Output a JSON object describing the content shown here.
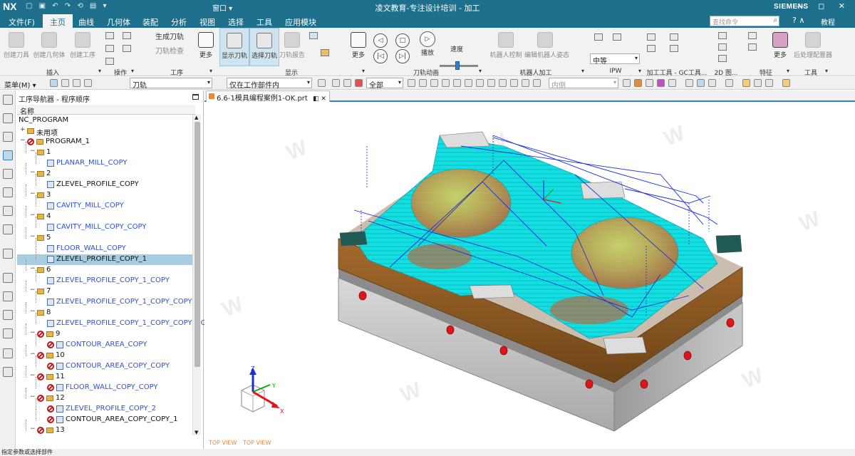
{
  "titlebar": {
    "logo": "NX",
    "quick_access": "▢ ▣ ↶ ↷ ⟲ ▤ ▾",
    "window_menu": "窗口 ▾",
    "title": "凌文教育-专注设计培训 - 加工",
    "brand": "SIEMENS",
    "window_controls": "— ◻ ✕"
  },
  "menubar": {
    "items": [
      "文件(F)",
      "主页",
      "曲线",
      "几何体",
      "装配",
      "分析",
      "视图",
      "选择",
      "工具",
      "应用模块"
    ],
    "active_index": 1,
    "search_placeholder": "查找命令",
    "help_label": "? ∧",
    "tutorial_label": "教程"
  },
  "ribbon": {
    "buttons": [
      {
        "label": "创建刀具",
        "enabled": false
      },
      {
        "label": "创建几何体",
        "enabled": false
      },
      {
        "label": "创建工序",
        "enabled": false
      },
      {
        "label": "生成刀轨",
        "enabled": false
      },
      {
        "label": "刀轨检查",
        "enabled": false
      },
      {
        "label": "更多",
        "enabled": true
      },
      {
        "label": "显示刀轨",
        "enabled": true,
        "toggled": true
      },
      {
        "label": "选择刀轨",
        "enabled": true,
        "toggled": true
      },
      {
        "label": "刀轨报告",
        "enabled": false
      },
      {
        "label": "更多",
        "enabled": true
      },
      {
        "label": "播放",
        "enabled": true
      },
      {
        "label": "速度",
        "enabled": true
      },
      {
        "label": "机器人控制",
        "enabled": false
      },
      {
        "label": "编辑机器人姿态",
        "enabled": false
      },
      {
        "label": "更多",
        "enabled": true
      },
      {
        "label": "后处理配置器",
        "enabled": false
      }
    ],
    "groups": [
      "插入",
      "操作",
      "工序",
      "显示",
      "刀轨动画",
      "机器人加工",
      "IPW",
      "加工工具 - GC工具...",
      "2D 图...",
      "特征",
      "工具"
    ],
    "ipw_select": "中等",
    "speed_value": 0.45
  },
  "toolbar2": {
    "menu_label": "菜单(M) ▾",
    "filter_select": "刀轨",
    "scope_select": "仅在工作部件内",
    "selection_select": "全部",
    "snap_select": "内侧"
  },
  "nav": {
    "title": "工序导航器 - 程序顺序",
    "column_name": "名称",
    "rows": [
      {
        "label": "NC_PROGRAM",
        "level": 0,
        "kind": "root",
        "expander": "",
        "color": "dark"
      },
      {
        "label": "未用项",
        "level": 0,
        "kind": "folder",
        "expander": "+",
        "color": "dark"
      },
      {
        "label": "PROGRAM_1",
        "level": 0,
        "kind": "program",
        "expander": "−",
        "color": "dark"
      },
      {
        "label": "1",
        "level": 1,
        "kind": "folder",
        "expander": "−",
        "color": "dark"
      },
      {
        "label": "PLANAR_MILL_COPY",
        "level": 2,
        "kind": "op",
        "expander": "",
        "color": "blue"
      },
      {
        "label": "2",
        "level": 1,
        "kind": "folder",
        "expander": "−",
        "color": "dark"
      },
      {
        "label": "ZLEVEL_PROFILE_COPY",
        "level": 2,
        "kind": "op",
        "expander": "",
        "color": "dark"
      },
      {
        "label": "3",
        "level": 1,
        "kind": "folder",
        "expander": "−",
        "color": "dark"
      },
      {
        "label": "CAVITY_MILL_COPY",
        "level": 2,
        "kind": "op",
        "expander": "",
        "color": "blue"
      },
      {
        "label": "4",
        "level": 1,
        "kind": "folder",
        "expander": "−",
        "color": "dark"
      },
      {
        "label": "CAVITY_MILL_COPY_COPY",
        "level": 2,
        "kind": "op",
        "expander": "",
        "color": "blue"
      },
      {
        "label": "5",
        "level": 1,
        "kind": "folder",
        "expander": "−",
        "color": "dark"
      },
      {
        "label": "FLOOR_WALL_COPY",
        "level": 2,
        "kind": "op",
        "expander": "",
        "color": "blue"
      },
      {
        "label": "ZLEVEL_PROFILE_COPY_1",
        "level": 2,
        "kind": "op",
        "expander": "",
        "color": "dark",
        "selected": true
      },
      {
        "label": "6",
        "level": 1,
        "kind": "folder",
        "expander": "−",
        "color": "dark"
      },
      {
        "label": "ZLEVEL_PROFILE_COPY_1_COPY",
        "level": 2,
        "kind": "op",
        "expander": "",
        "color": "blue"
      },
      {
        "label": "7",
        "level": 1,
        "kind": "folder",
        "expander": "−",
        "color": "dark"
      },
      {
        "label": "ZLEVEL_PROFILE_COPY_1_COPY_COPY",
        "level": 2,
        "kind": "op",
        "expander": "",
        "color": "blue"
      },
      {
        "label": "8",
        "level": 1,
        "kind": "folder",
        "expander": "−",
        "color": "dark"
      },
      {
        "label": "ZLEVEL_PROFILE_COPY_1_COPY_COPY_CO",
        "level": 2,
        "kind": "op",
        "expander": "",
        "color": "blue"
      },
      {
        "label": "9",
        "level": 1,
        "kind": "program",
        "expander": "−",
        "color": "dark"
      },
      {
        "label": "CONTOUR_AREA_COPY",
        "level": 2,
        "kind": "op-x",
        "expander": "",
        "color": "blue"
      },
      {
        "label": "10",
        "level": 1,
        "kind": "program",
        "expander": "−",
        "color": "dark"
      },
      {
        "label": "CONTOUR_AREA_COPY_COPY",
        "level": 2,
        "kind": "op-x",
        "expander": "",
        "color": "blue"
      },
      {
        "label": "11",
        "level": 1,
        "kind": "program",
        "expander": "−",
        "color": "dark"
      },
      {
        "label": "FLOOR_WALL_COPY_COPY",
        "level": 2,
        "kind": "op-x",
        "expander": "",
        "color": "blue"
      },
      {
        "label": "12",
        "level": 1,
        "kind": "program",
        "expander": "−",
        "color": "dark"
      },
      {
        "label": "ZLEVEL_PROFILE_COPY_2",
        "level": 2,
        "kind": "op-x",
        "expander": "",
        "color": "blue"
      },
      {
        "label": "CONTOUR_AREA_COPY_COPY_1",
        "level": 2,
        "kind": "op-x",
        "expander": "",
        "color": "dark"
      },
      {
        "label": "13",
        "level": 1,
        "kind": "program",
        "expander": "−",
        "color": "dark"
      }
    ]
  },
  "document": {
    "tab_label": "6.6-1模具编程案例1-OK.prt",
    "view_labels": [
      "TOP VIEW",
      "TOP VIEW"
    ],
    "triad": {
      "x": "X",
      "y": "Y",
      "z": "Z"
    }
  },
  "statusbar": {
    "text": "指定参数或选择部件"
  },
  "colors": {
    "title_bar": "#1e6f8c",
    "toolpath_cyan": "#12e0e0",
    "mold_base_gray": "#b7b7b7",
    "plate_bronze": "#8c5a24",
    "hole_red": "#e0141a",
    "selection_blue": "#a7cde3"
  }
}
